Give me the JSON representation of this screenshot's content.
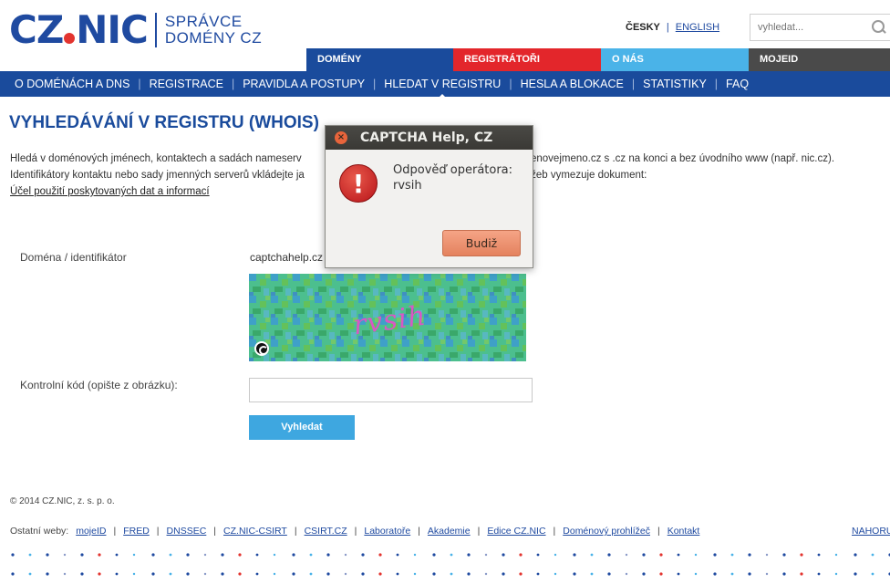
{
  "header": {
    "logo": {
      "main_left": "CZ",
      "main_right": "NIC",
      "sub_line1": "SPRÁVCE",
      "sub_line2": "DOMÉNY CZ"
    },
    "lang": {
      "active": "ČESKY",
      "separator": "|",
      "other": "ENGLISH"
    },
    "search": {
      "placeholder": "vyhledat...",
      "icon": "search-icon"
    }
  },
  "tabs": {
    "domeny": "DOMÉNY",
    "registratori": "REGISTRÁTOŘI",
    "onas": "O NÁS",
    "mojeid": "MOJEID"
  },
  "colors": {
    "brand_blue": "#1a4b9c",
    "registrars_red": "#e3262b",
    "about_cyan": "#4ab3e8",
    "mojeid_gray": "#4a4a4a",
    "button_blue": "#3ea7e0",
    "dialog_button": "#e4825e"
  },
  "subnav": {
    "items": [
      "O DOMÉNÁCH A DNS",
      "REGISTRACE",
      "PRAVIDLA A POSTUPY",
      "HLEDAT V REGISTRU",
      "HESLA A BLOKACE",
      "STATISTIKY",
      "FAQ"
    ],
    "separator": "|",
    "current": "HLEDAT V REGISTRU"
  },
  "main": {
    "title": "VYHLEDÁVÁNÍ V REGISTRU (WHOIS)",
    "intro_line1_left": "Hledá v doménových jménech, kontaktech a sadách nameserv",
    "intro_line1_right": "domenovejmeno.cz s .cz na konci a bez úvodního www (např. nic.cz).",
    "intro_line2_left": "Identifikátory kontaktu nebo sady jmenných serverů vkládejte ja",
    "intro_line2_right": "h služeb vymezuje dokument:",
    "intro_link": "Účel použití poskytovaných dat a informací",
    "domain_label": "Doména / identifikátor",
    "domain_value": "captchahelp.cz",
    "captcha_text": "rvsih",
    "captcha_reload_icon": "reload-icon",
    "code_label": "Kontrolní kód (opište z obrázku):",
    "code_value": "",
    "submit_label": "Vyhledat"
  },
  "footer": {
    "copyright": "© 2014 CZ.NIC, z. s. p. o.",
    "links_label": "Ostatní weby:",
    "links": [
      "mojeID",
      "FRED",
      "DNSSEC",
      "CZ.NIC-CSIRT",
      "CSIRT.CZ",
      "Laboratoře",
      "Akademie",
      "Edice CZ.NIC",
      "Doménový prohlížeč",
      "Kontakt"
    ],
    "separator": "|",
    "top_link": "NAHORU"
  },
  "dialog": {
    "title": "CAPTCHA Help, CZ",
    "close_icon": "close-icon",
    "error_icon": "error-icon",
    "message_line1": "Odpověď operátora:",
    "message_line2": "rvsih",
    "button_label": "Budiž"
  }
}
